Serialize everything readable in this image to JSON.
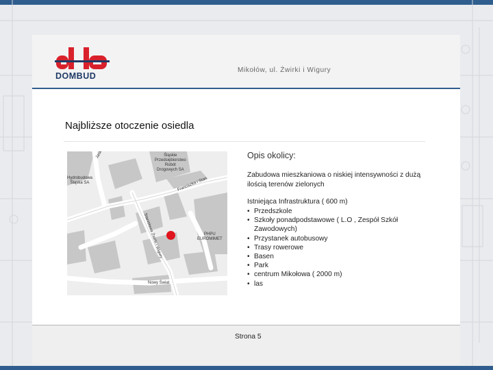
{
  "header": {
    "logo_text": "DOMBUD",
    "address": "Mikołów, ul. Żwirki i Wigury"
  },
  "title": "Najbliższe otoczenie osiedla",
  "map": {
    "labels": {
      "jasko": "Jasko",
      "slaskie": "Śląskie\nPrzedsiębiorstwo\nRobót\nDrogowych SA",
      "hydro": "Hydrobudowa\nŚląska SA",
      "franciszka": "Franciszka i Stan",
      "phpu": "PHPU\nEUROMIMET",
      "stanislawa": "Stanisława Żwirki i Wigury",
      "nowy_swiat": "Nowy Świat"
    }
  },
  "description": {
    "heading": "Opis okolicy:",
    "paragraph": "Zabudowa mieszkaniowa o niskiej intensywności z dużą ilością terenów zielonych",
    "infra_heading": "Istniejąca Infrastruktura ( 600 m)",
    "bullet": "•",
    "items": [
      "Przedszkole",
      "Szkoły ponadpodstawowe ( L.O , Zespół Szkół Zawodowych)",
      "Przystanek autobusowy",
      "Trasy rowerowe",
      "Basen",
      "Park",
      "centrum Mikołowa ( 2000 m)",
      "las"
    ]
  },
  "footer": {
    "page": "Strona 5"
  },
  "colors": {
    "accent": "#2f5d8e",
    "logo_red": "#d9212c",
    "logo_blue": "#1f3a66",
    "pin": "#e0141e"
  }
}
